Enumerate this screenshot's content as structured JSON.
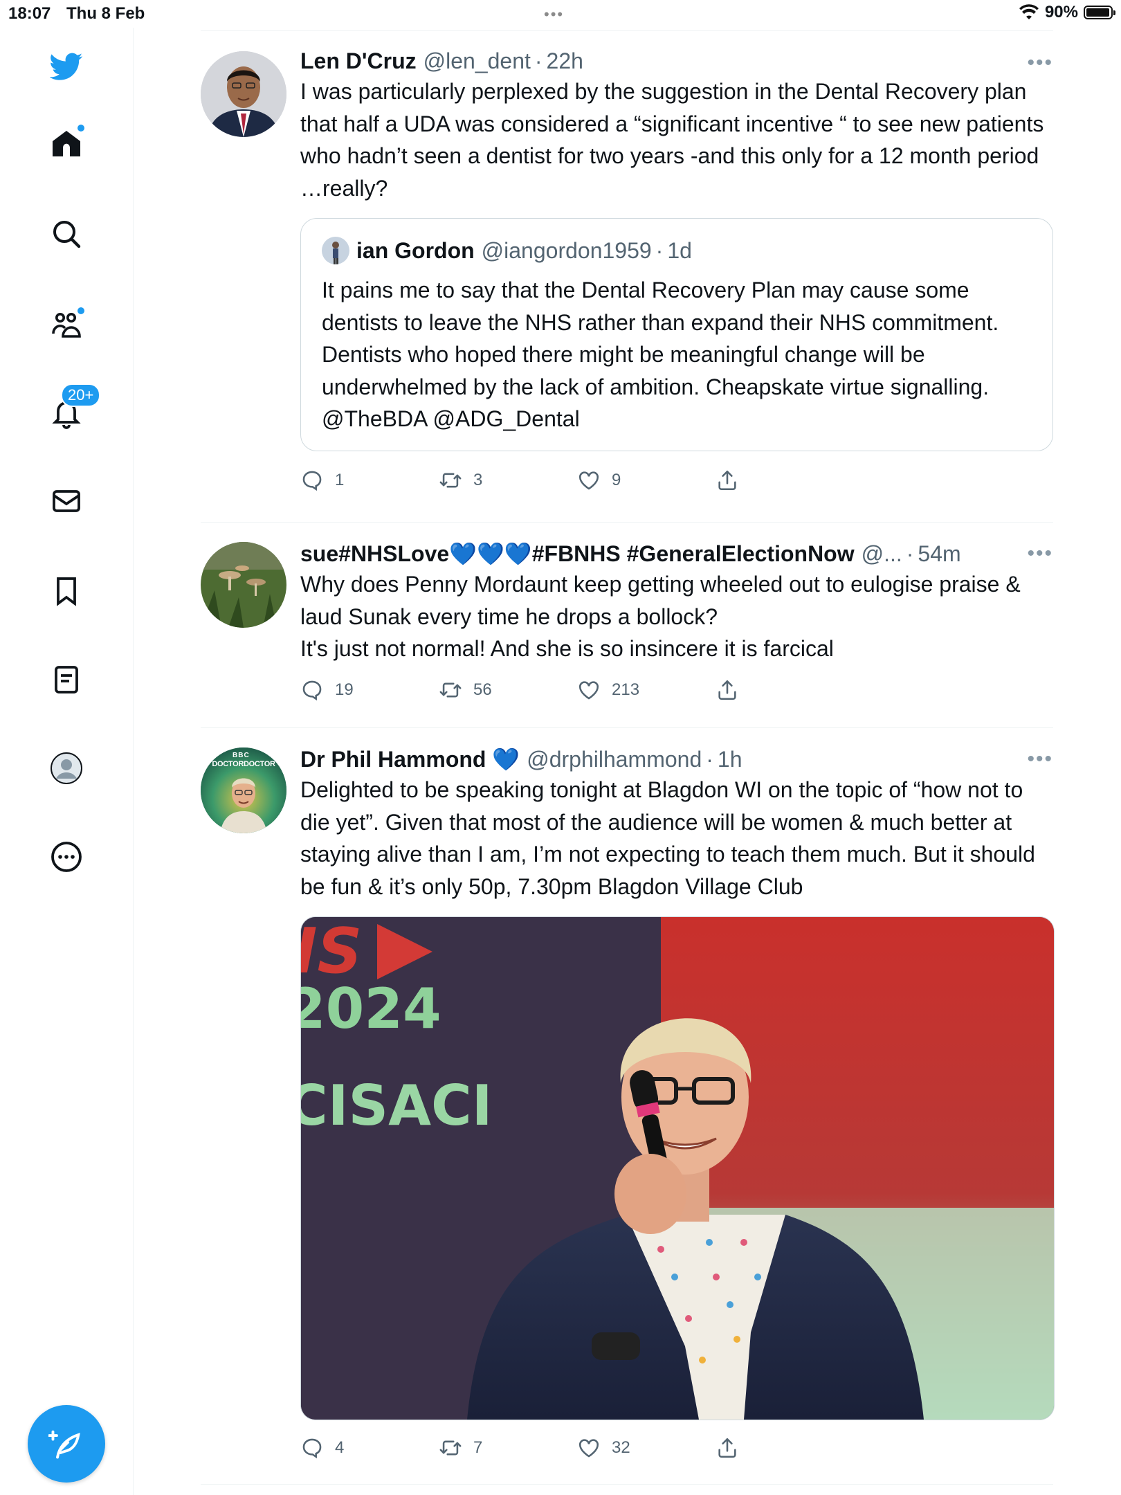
{
  "status": {
    "time": "18:07",
    "date": "Thu 8 Feb",
    "battery": "90%"
  },
  "sidebar": {
    "items": [
      {
        "icon": "twitter-bird-icon",
        "label": "Twitter"
      },
      {
        "icon": "home-icon",
        "label": "Home"
      },
      {
        "icon": "search-icon",
        "label": "Search"
      },
      {
        "icon": "communities-icon",
        "label": "Communities"
      },
      {
        "icon": "bell-icon",
        "label": "Notifications"
      },
      {
        "icon": "mail-icon",
        "label": "Messages"
      },
      {
        "icon": "bookmark-icon",
        "label": "Bookmarks"
      },
      {
        "icon": "lists-icon",
        "label": "Lists"
      },
      {
        "icon": "profile-icon",
        "label": "Profile"
      },
      {
        "icon": "more-circle-icon",
        "label": "More"
      }
    ],
    "notifications_badge": "20+",
    "compose_icon": "compose-tweet-icon"
  },
  "colors": {
    "accent": "#1d9bf0",
    "text": "#0f1419",
    "secondary": "#536471",
    "border": "#eff3f4"
  },
  "tweets": [
    {
      "name": "Len D'Cruz",
      "handle": "@len_dent",
      "time": "22h",
      "text": "I was particularly perplexed by the suggestion in the Dental Recovery plan that half a UDA was  considered a “significant incentive “ to see new patients who hadn’t seen a dentist for two years -and this only for a 12 month period …really?",
      "quote": {
        "name": "ian Gordon",
        "handle": "@iangordon1959",
        "time": "1d",
        "text": "It pains me to say that the Dental Recovery Plan may cause some dentists to leave the NHS rather than expand their NHS commitment. Dentists who hoped there might be meaningful change will be underwhelmed by the lack of ambition. Cheapskate virtue signalling. @TheBDA @ADG_Dental"
      },
      "replies": "1",
      "retweets": "3",
      "likes": "9"
    },
    {
      "name": "sue#NHSLove💙💙💙#FBNHS #GeneralElectionNow",
      "handle": "@...",
      "time": "54m",
      "text": "Why does Penny Mordaunt keep getting wheeled out to eulogise praise & laud Sunak every time he drops a bollock?\nIt's just not normal! And she is so insincere it is farcical",
      "replies": "19",
      "retweets": "56",
      "likes": "213"
    },
    {
      "name": "Dr Phil Hammond 💙",
      "handle": "@drphilhammond",
      "time": "1h",
      "text": "Delighted to be speaking tonight at Blagdon WI on the topic of “how not to die yet”. Given that most of the audience will be women & much better at staying alive than I am, I’m not expecting to teach them much. But it should be fun & it’s only 50p, 7.30pm Blagdon Village Club",
      "avatar_text_top": "BBC",
      "avatar_text": "DOCTORDOCTOR",
      "media": {
        "sign_line1": "IS",
        "sign_line2": "2024",
        "sign_line3": "CISACI"
      },
      "replies": "4",
      "retweets": "7",
      "likes": "32"
    }
  ]
}
